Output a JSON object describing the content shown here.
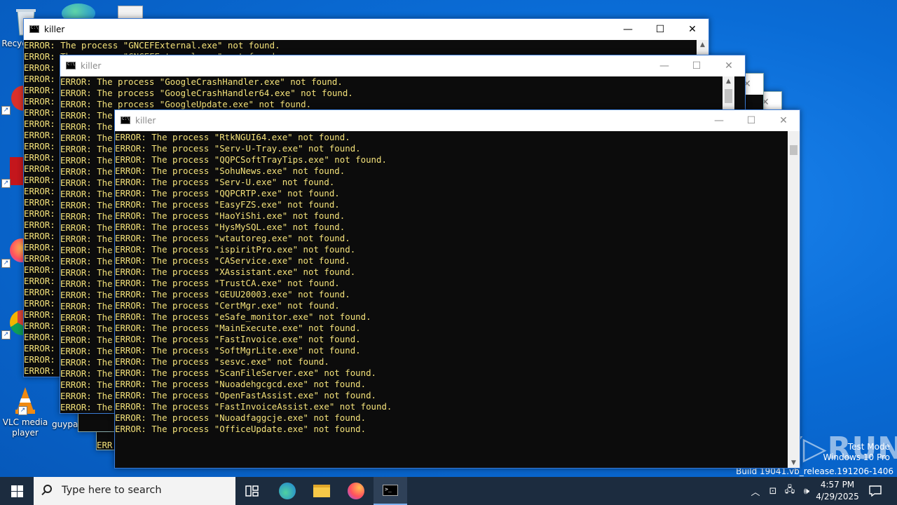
{
  "desktop": {
    "icons": [
      {
        "label": "Recycle Bin"
      },
      {
        "label": "CCleaner"
      },
      {
        "label": "Adobe Acrobat"
      },
      {
        "label": "Firefox"
      },
      {
        "label": "Google Chrome"
      },
      {
        "label": "VLC media player"
      },
      {
        "label": "guypa"
      }
    ]
  },
  "windows": {
    "w1": {
      "title": "killer",
      "lines": [
        "ERROR: The process \"GNCEFExternal.exe\" not found.",
        "ERROR: The process \"GNCEFExternal.exe\" not found."
      ],
      "prefix": "ERROR:",
      "prefix_count": 29
    },
    "w2": {
      "title": "killer",
      "lines": [
        "ERROR: The process \"GoogleCrashHandler.exe\" not found.",
        "ERROR: The process \"GoogleCrashHandler64.exe\" not found.",
        "ERROR: The process \"GoogleUpdate.exe\" not found."
      ],
      "prefix": "ERROR: The",
      "prefix_count": 30
    },
    "w3": {
      "title": "killer",
      "lines": [
        "ERROR: The process \"RtkNGUI64.exe\" not found.",
        "ERROR: The process \"Serv-U-Tray.exe\" not found.",
        "ERROR: The process \"QQPCSoftTrayTips.exe\" not found.",
        "ERROR: The process \"SohuNews.exe\" not found.",
        "ERROR: The process \"Serv-U.exe\" not found.",
        "ERROR: The process \"QQPCRTP.exe\" not found.",
        "ERROR: The process \"EasyFZS.exe\" not found.",
        "ERROR: The process \"HaoYiShi.exe\" not found.",
        "ERROR: The process \"HysMySQL.exe\" not found.",
        "ERROR: The process \"wtautoreg.exe\" not found.",
        "ERROR: The process \"ispiritPro.exe\" not found.",
        "ERROR: The process \"CAService.exe\" not found.",
        "ERROR: The process \"XAssistant.exe\" not found.",
        "ERROR: The process \"TrustCA.exe\" not found.",
        "ERROR: The process \"GEUU20003.exe\" not found.",
        "ERROR: The process \"CertMgr.exe\" not found.",
        "ERROR: The process \"eSafe_monitor.exe\" not found.",
        "ERROR: The process \"MainExecute.exe\" not found.",
        "ERROR: The process \"FastInvoice.exe\" not found.",
        "ERROR: The process \"SoftMgrLite.exe\" not found.",
        "ERROR: The process \"sesvc.exe\" not found.",
        "ERROR: The process \"ScanFileServer.exe\" not found.",
        "ERROR: The process \"Nuoadehgcgcd.exe\" not found.",
        "ERROR: The process \"OpenFastAssist.exe\" not found.",
        "ERROR: The process \"FastInvoiceAssist.exe\" not found.",
        "ERROR: The process \"Nuoadfaggcje.exe\" not found.",
        "ERROR: The process \"OfficeUpdate.exe\" not found."
      ]
    },
    "behind": {
      "prefix": "ERR"
    }
  },
  "watermark": {
    "line1": "Test Mode",
    "line2": "Windows 10 Pro",
    "line3": "Build 19041.vb_release.191206-1406",
    "brand": "ANY RUN"
  },
  "taskbar": {
    "search_placeholder": "Type here to search",
    "time": "4:57 PM",
    "date": "4/29/2025"
  },
  "colors": {
    "console_text": "#f4e27a",
    "console_bg": "#0c0c0c",
    "desktop": "#0a6cd6",
    "taskbar": "#1c2c3f"
  }
}
